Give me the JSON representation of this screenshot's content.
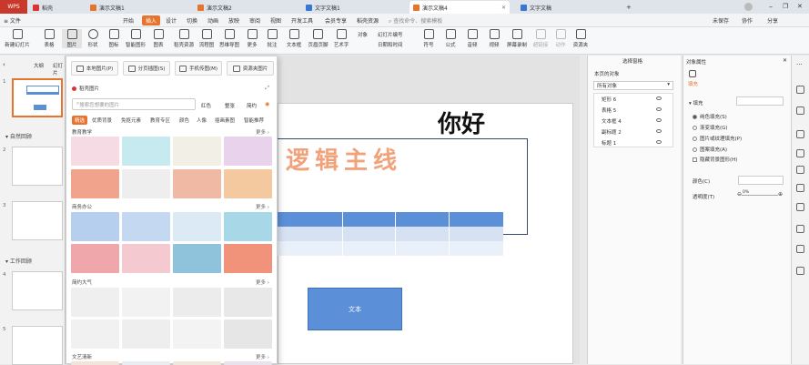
{
  "tabs": {
    "wps": "WPS",
    "t1": "稻壳",
    "t2": "演示文稿1",
    "t3": "演示文稿2",
    "t4": "文字文稿1",
    "t5": "演示文稿4",
    "t6": "文字文稿",
    "sync": "未保存",
    "collab": "协作",
    "share": "分享"
  },
  "menu": [
    "≡ 文件",
    "开始",
    "插入",
    "设计",
    "切换",
    "动画",
    "放映",
    "审阅",
    "视图",
    "开发工具",
    "会员专享",
    "稻壳资源"
  ],
  "menu_search": "查找命令、搜索模板",
  "ribbon": [
    "新建幻灯片",
    "表格",
    "图片",
    "形状",
    "图标",
    "智能图形",
    "图表",
    "稻壳资源",
    "流程图",
    "思维导图",
    "更多",
    "批注",
    "文本框",
    "页眉页脚",
    "艺术字",
    "对象",
    "幻灯片编号",
    "日期和时间",
    "符号",
    "公式",
    "音频",
    "视频",
    "屏幕录制",
    "超链接",
    "动作",
    "资源夹"
  ],
  "left_panel": {
    "tab_outline": "大纲",
    "tab_slides": "幻灯片",
    "section1": "自然回顾",
    "section2": "工作回顾",
    "slide_numbers": [
      "1",
      "2",
      "3",
      "4",
      "5"
    ]
  },
  "popup": {
    "btn_local": "本地图片(P)",
    "btn_split": "分页插图(S)",
    "btn_phone": "手机传图(M)",
    "btn_res": "资源夹图片",
    "header": "稻壳图片",
    "search_placeholder": "搜索您想要的图片",
    "filters": [
      "红色",
      "整张",
      "简约"
    ],
    "categories": [
      "精选",
      "优质背景",
      "免抠元素",
      "教育专区",
      "颜色",
      "人像",
      "插画素图",
      "智能推荐"
    ],
    "sections": [
      "教育教学",
      "商务办公",
      "简约大气",
      "文艺清新"
    ],
    "more": "更多"
  },
  "slide": {
    "title": "你好",
    "wordart": "逻辑主线",
    "shape_text": "文本"
  },
  "selection_pane": {
    "title": "选择窗格",
    "subtitle": "本页的对象",
    "dropdown": "所有对象",
    "objects": [
      "矩形 6",
      "表格 5",
      "文本框 4",
      "副标题 2",
      "标题 1"
    ]
  },
  "property_pane": {
    "title": "对象属性",
    "tab_fill": "填充",
    "section": "填充",
    "options": [
      "纯色填充(S)",
      "渐变填充(G)",
      "图片或纹理填充(P)",
      "图案填充(A)",
      "隐藏背景图形(H)"
    ],
    "color_label": "颜色(C)",
    "transparency_label": "透明度(T)",
    "transparency_value": "0%"
  },
  "colors": {
    "accent": "#e6742f",
    "table_header": "#5b8fd8",
    "shape_fill": "#5b8fd8"
  }
}
